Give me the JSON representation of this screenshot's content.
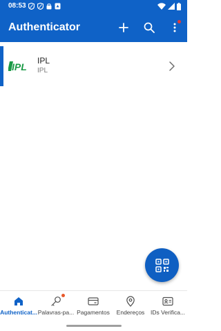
{
  "status_bar": {
    "time": "08:53"
  },
  "header": {
    "title": "Authenticator",
    "background_color": "#0f62c7",
    "actions": [
      {
        "icon": "plus-icon"
      },
      {
        "icon": "search-icon"
      },
      {
        "icon": "more-vertical-icon",
        "has_notification": true
      }
    ]
  },
  "accounts": [
    {
      "logo_text": "IPL",
      "name": "IPL",
      "subtitle": "IPL",
      "selected": true
    }
  ],
  "fab": {
    "icon": "qr-code-icon"
  },
  "bottom_nav": {
    "items": [
      {
        "label": "Authenticat...",
        "icon": "home-icon",
        "active": true
      },
      {
        "label": "Palavras-pa...",
        "icon": "key-icon",
        "badge": true
      },
      {
        "label": "Pagamentos",
        "icon": "card-icon"
      },
      {
        "label": "Endereços",
        "icon": "location-icon"
      },
      {
        "label": "IDs Verifica...",
        "icon": "id-card-icon"
      }
    ]
  },
  "colors": {
    "accent": "#0f62c7",
    "logo_green": "#1a9a46",
    "badge": "#e8582a"
  }
}
